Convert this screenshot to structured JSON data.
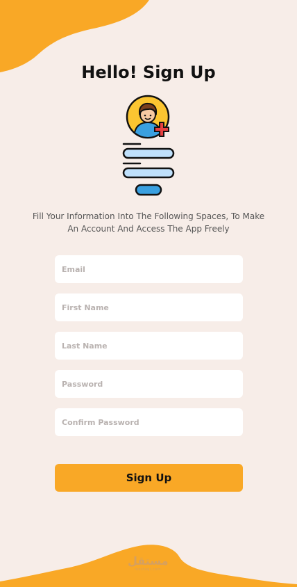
{
  "page": {
    "title": "Hello! Sign Up",
    "subtitle": "Fill Your Information Into The Following Spaces, To Make An Account And Access The App Freely"
  },
  "form": {
    "fields": [
      {
        "placeholder": "Email",
        "value": ""
      },
      {
        "placeholder": "First Name",
        "value": ""
      },
      {
        "placeholder": "Last Name",
        "value": ""
      },
      {
        "placeholder": "Password",
        "value": ""
      },
      {
        "placeholder": "Confirm Password",
        "value": ""
      }
    ],
    "submit_label": "Sign Up"
  },
  "watermark": {
    "main": "مستقل",
    "sub": "mostaql.com"
  },
  "icons": {
    "illustration": "user-add-form-icon"
  },
  "colors": {
    "background": "#f7ede8",
    "accent": "#f9a826",
    "field_bg": "#ffffff",
    "placeholder": "#b9b2b0"
  }
}
